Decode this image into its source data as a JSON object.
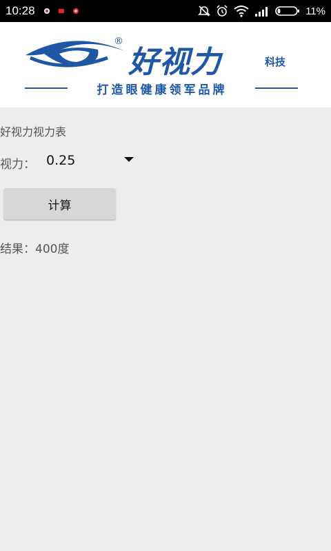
{
  "status_bar": {
    "time": "10:28",
    "battery_percent": "11%",
    "icons": [
      "notification-icon-1",
      "notification-icon-2",
      "notification-icon-3",
      "alarm-off-icon",
      "alarm-clock-icon",
      "wifi-icon",
      "signal-icon",
      "battery-icon"
    ]
  },
  "banner": {
    "brand_name": "好视力",
    "brand_suffix": "科技",
    "registered_mark": "®",
    "slogan": "打造眼健康领军品牌",
    "brand_color": "#1f57a5"
  },
  "main": {
    "title": "好视力视力表",
    "vision_label": "视力：",
    "vision_selected": "0.25",
    "calculate_button": "计算",
    "result_text": "结果：400度"
  }
}
